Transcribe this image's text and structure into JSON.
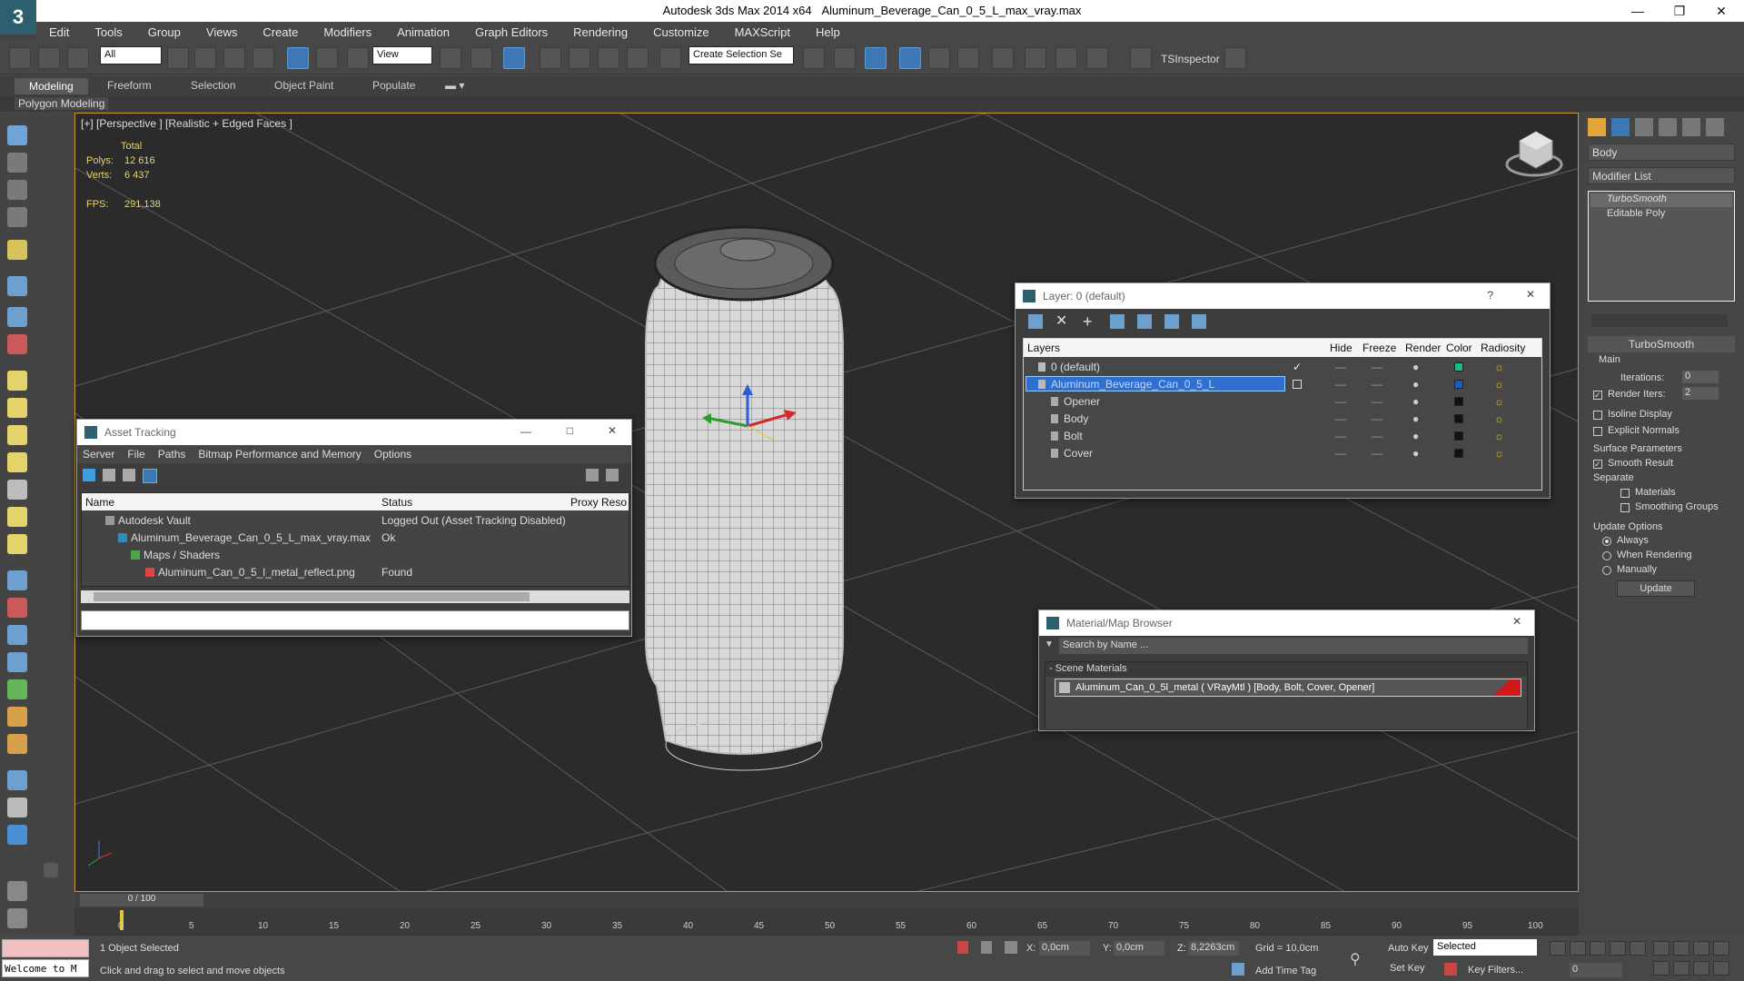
{
  "titlebar": {
    "app": "Autodesk 3ds Max  2014 x64",
    "file": "Aluminum_Beverage_Can_0_5_L_max_vray.max"
  },
  "menu": [
    "Edit",
    "Tools",
    "Group",
    "Views",
    "Create",
    "Modifiers",
    "Animation",
    "Graph Editors",
    "Rendering",
    "Customize",
    "MAXScript",
    "Help"
  ],
  "toolbar": {
    "selection_filter": "All",
    "ref_coord": "View",
    "named_sel": "Create Selection Se",
    "ts_inspector": "TSInspector"
  },
  "ribbon": {
    "tabs": [
      "Modeling",
      "Freeform",
      "Selection",
      "Object Paint",
      "Populate"
    ],
    "active": "Modeling",
    "panel": "Polygon Modeling"
  },
  "viewport": {
    "label": "[+] [Perspective ] [Realistic + Edged Faces ]",
    "stats": {
      "total": "Total",
      "polys_label": "Polys:",
      "polys": "12 616",
      "verts_label": "Verts:",
      "verts": "6 437",
      "fps_label": "FPS:",
      "fps": "291,138"
    }
  },
  "asset_tracking": {
    "title": "Asset Tracking",
    "menu": [
      "Server",
      "File",
      "Paths",
      "Bitmap Performance and Memory",
      "Options"
    ],
    "columns": [
      "Name",
      "Status",
      "Proxy Reso"
    ],
    "rows": [
      {
        "name": "Autodesk Vault",
        "status": "Logged Out (Asset Tracking Disabled)"
      },
      {
        "name": "Aluminum_Beverage_Can_0_5_L_max_vray.max",
        "status": "Ok"
      },
      {
        "name": "Maps / Shaders",
        "status": ""
      },
      {
        "name": "Aluminum_Can_0_5_l_metal_reflect.png",
        "status": "Found"
      }
    ]
  },
  "layer_dialog": {
    "title": "Layer: 0 (default)",
    "columns": [
      "Layers",
      "Hide",
      "Freeze",
      "Render",
      "Color",
      "Radiosity"
    ],
    "rows": [
      {
        "name": "0 (default)",
        "color": "#1fb88a"
      },
      {
        "name": "Aluminum_Beverage_Can_0_5_L",
        "color": "#1a5fb4"
      },
      {
        "name": "Opener",
        "color": "#111111"
      },
      {
        "name": "Body",
        "color": "#111111"
      },
      {
        "name": "Bolt",
        "color": "#111111"
      },
      {
        "name": "Cover",
        "color": "#111111"
      }
    ]
  },
  "material_browser": {
    "title": "Material/Map Browser",
    "search_placeholder": "Search by Name ...",
    "section": "- Scene Materials",
    "item": "Aluminum_Can_0_5l_metal  ( VRayMtl ) [Body, Bolt, Cover, Opener]"
  },
  "command_panel": {
    "object_name": "Body",
    "modifier_list": "Modifier List",
    "stack": [
      "TurboSmooth",
      "Editable Poly"
    ],
    "rollout": "TurboSmooth",
    "main": "Main",
    "iterations_label": "Iterations:",
    "iterations": "0",
    "render_iters_label": "Render Iters:",
    "render_iters": "2",
    "isoline": "Isoline Display",
    "explicit": "Explicit Normals",
    "surface": "Surface Parameters",
    "smooth_result": "Smooth Result",
    "separate": "Separate",
    "materials": "Materials",
    "smoothing_groups": "Smoothing Groups",
    "update_options": "Update Options",
    "always": "Always",
    "when_rendering": "When Rendering",
    "manually": "Manually",
    "update_btn": "Update"
  },
  "timeline": {
    "frame": "0 / 100",
    "ticks": [
      "0",
      "5",
      "10",
      "15",
      "20",
      "25",
      "30",
      "35",
      "40",
      "45",
      "50",
      "55",
      "60",
      "65",
      "70",
      "75",
      "80",
      "85",
      "90",
      "95",
      "100"
    ]
  },
  "status": {
    "welcome": "Welcome to M",
    "selected": "1 Object Selected",
    "prompt": "Click and drag to select and move objects",
    "x_label": "X:",
    "x": "0,0cm",
    "y_label": "Y:",
    "y": "0,0cm",
    "z_label": "Z:",
    "z": "8,2263cm",
    "grid": "Grid = 10,0cm",
    "add_time_tag": "Add Time Tag",
    "auto_key": "Auto Key",
    "set_key": "Set Key",
    "key_mode": "Selected",
    "key_filters": "Key Filters...",
    "frame_field": "0"
  }
}
